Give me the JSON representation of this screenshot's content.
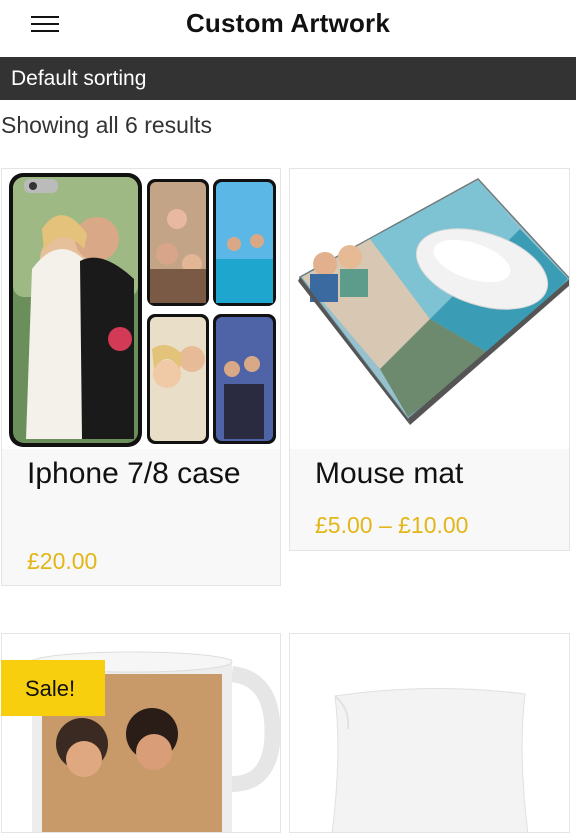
{
  "header": {
    "title": "Custom Artwork",
    "menu_icon": "hamburger-menu-icon"
  },
  "sort": {
    "label": "Default sorting"
  },
  "results_text": "Showing all 6 results",
  "products": [
    {
      "name": "Iphone 7/8 case",
      "price": "£20.00"
    },
    {
      "name": "Mouse mat",
      "price": "£5.00 – £10.00"
    },
    {
      "name": "",
      "price": "",
      "badge": "Sale!"
    },
    {
      "name": "",
      "price": ""
    }
  ],
  "colors": {
    "accent": "#e3b617",
    "sale_badge": "#f7cf0e",
    "sortbar": "#333333"
  }
}
